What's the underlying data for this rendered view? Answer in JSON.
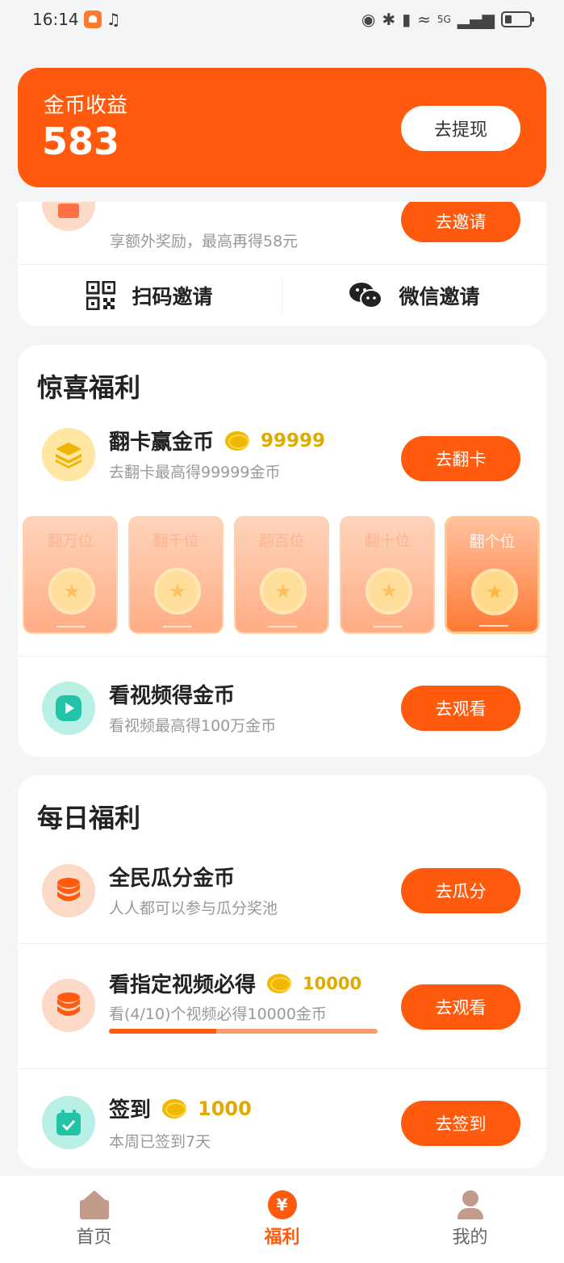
{
  "status_bar": {
    "time": "16:14",
    "network": "5G"
  },
  "coin_header": {
    "label": "金币收益",
    "value": "583",
    "withdraw_label": "去提现"
  },
  "invite": {
    "subtitle": "享额外奖励，最高再得58元",
    "button_label": "去邀请",
    "qr_label": "扫码邀请",
    "wechat_label": "微信邀请"
  },
  "surprise": {
    "title": "惊喜福利",
    "flip": {
      "title": "翻卡赢金币",
      "amount": "99999",
      "subtitle": "去翻卡最高得99999金币",
      "button_label": "去翻卡",
      "cards": [
        "翻万位",
        "翻千位",
        "翻百位",
        "翻十位",
        "翻个位"
      ]
    },
    "video": {
      "title": "看视频得金币",
      "subtitle": "看视频最高得100万金币",
      "button_label": "去观看"
    }
  },
  "daily": {
    "title": "每日福利",
    "share": {
      "title": "全民瓜分金币",
      "subtitle": "人人都可以参与瓜分奖池",
      "button_label": "去瓜分"
    },
    "watch": {
      "title": "看指定视频必得",
      "amount": "10000",
      "subtitle": "看(4/10)个视频必得10000金币",
      "button_label": "去观看",
      "progress": 0.4
    },
    "checkin": {
      "title": "签到",
      "amount": "1000",
      "subtitle": "本周已签到7天",
      "button_label": "去签到"
    }
  },
  "tabs": [
    {
      "label": "首页"
    },
    {
      "label": "福利",
      "icon_char": "¥"
    },
    {
      "label": "我的"
    }
  ],
  "colors": {
    "accent": "#ff5a0d",
    "coin": "#e0a800",
    "teal_icon_bg": "#b8f0e6",
    "teal_icon": "#22c3a6",
    "orange_icon_bg": "#fdd9c8"
  }
}
